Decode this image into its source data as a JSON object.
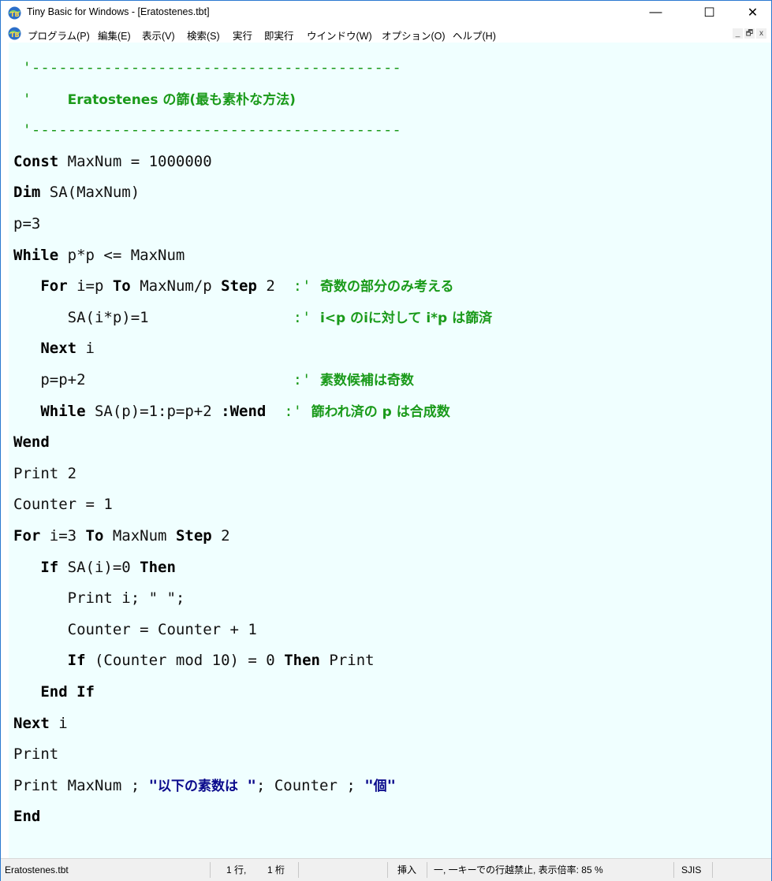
{
  "window": {
    "title": "Tiny Basic for Windows - [Eratostenes.tbt]",
    "minimize": "—",
    "maximize": "☐",
    "close": "✕"
  },
  "menu": {
    "items": [
      "プログラム(P)",
      "編集(E)",
      "表示(V)",
      "検索(S)",
      "実行",
      "即実行",
      "ウインドウ(W)",
      "オプション(O)",
      "ヘルプ(H)"
    ],
    "mdi": [
      "_",
      "🗗",
      "x"
    ]
  },
  "code": [
    [
      [
        "cm",
        " '-----------------------------------------"
      ]
    ],
    [
      [
        "cm",
        " '    "
      ],
      [
        "cmb",
        "Eratostenes の篩(最も素朴な方法)"
      ]
    ],
    [
      [
        "cm",
        " '-----------------------------------------"
      ]
    ],
    [
      [
        "kw",
        "Const"
      ],
      [
        "",
        " MaxNum = 1000000"
      ]
    ],
    [
      [
        "kw",
        "Dim"
      ],
      [
        "",
        " SA(MaxNum)"
      ]
    ],
    [
      [
        "",
        "p=3"
      ]
    ],
    [
      [
        "kw",
        "While"
      ],
      [
        "",
        " p*p <= MaxNum"
      ]
    ],
    [
      [
        "",
        "   "
      ],
      [
        "kw",
        "For"
      ],
      [
        "",
        " i=p "
      ],
      [
        "kw",
        "To"
      ],
      [
        "",
        " MaxNum/p "
      ],
      [
        "kw",
        "Step"
      ],
      [
        "",
        " 2  "
      ],
      [
        "cm",
        ":' "
      ],
      [
        "cmb",
        "奇数の部分のみ考える"
      ]
    ],
    [
      [
        "",
        "      SA(i*p)=1                "
      ],
      [
        "cm",
        ":' "
      ],
      [
        "cmb",
        "i<p のiに対して i*p は篩済"
      ]
    ],
    [
      [
        "",
        "   "
      ],
      [
        "kw",
        "Next"
      ],
      [
        "",
        " i"
      ]
    ],
    [
      [
        "",
        "   p=p+2                       "
      ],
      [
        "cm",
        ":' "
      ],
      [
        "cmb",
        "素数候補は奇数"
      ]
    ],
    [
      [
        "",
        "   "
      ],
      [
        "kw",
        "While"
      ],
      [
        "",
        " SA(p)=1:p=p+2 "
      ],
      [
        "kw",
        ":Wend"
      ],
      [
        "",
        "  "
      ],
      [
        "cm",
        ":' "
      ],
      [
        "cmb",
        "篩われ済の p は合成数"
      ]
    ],
    [
      [
        "kw",
        "Wend"
      ]
    ],
    [
      [
        "",
        "Print 2"
      ]
    ],
    [
      [
        "",
        "Counter = 1"
      ]
    ],
    [
      [
        "kw",
        "For"
      ],
      [
        "",
        " i=3 "
      ],
      [
        "kw",
        "To"
      ],
      [
        "",
        " MaxNum "
      ],
      [
        "kw",
        "Step"
      ],
      [
        "",
        " 2"
      ]
    ],
    [
      [
        "",
        "   "
      ],
      [
        "kw",
        "If"
      ],
      [
        "",
        " SA(i)=0 "
      ],
      [
        "kw",
        "Then"
      ]
    ],
    [
      [
        "",
        "      Print i; \" \";"
      ]
    ],
    [
      [
        "",
        "      Counter = Counter + 1"
      ]
    ],
    [
      [
        "",
        "      "
      ],
      [
        "kw",
        "If"
      ],
      [
        "",
        " (Counter mod 10) = 0 "
      ],
      [
        "kw",
        "Then"
      ],
      [
        "",
        " Print"
      ]
    ],
    [
      [
        "",
        "   "
      ],
      [
        "kw",
        "End If"
      ]
    ],
    [
      [
        "kw",
        "Next"
      ],
      [
        "",
        " i"
      ]
    ],
    [
      [
        "",
        "Print"
      ]
    ],
    [
      [
        "",
        "Print MaxNum ; "
      ],
      [
        "str",
        "\""
      ],
      [
        "str-jp",
        "以下の素数は"
      ],
      [
        "str",
        " \""
      ],
      [
        "",
        "; Counter ; "
      ],
      [
        "str",
        "\""
      ],
      [
        "str-jp",
        "個"
      ],
      [
        "str",
        "\""
      ]
    ],
    [
      [
        "kw",
        "End"
      ]
    ]
  ],
  "status": {
    "file": "Eratostenes.tbt",
    "row": "1 行,",
    "col": "1 桁",
    "mode": "挿入",
    "info": "一, 一キーでの行越禁止, 表示倍率: 85 %",
    "encoding": "SJIS"
  },
  "colors": {
    "editor_bg": "#f0ffff",
    "comment": "#1a9a1a",
    "string": "#0a0a8c",
    "title_border": "#2b79d0"
  }
}
